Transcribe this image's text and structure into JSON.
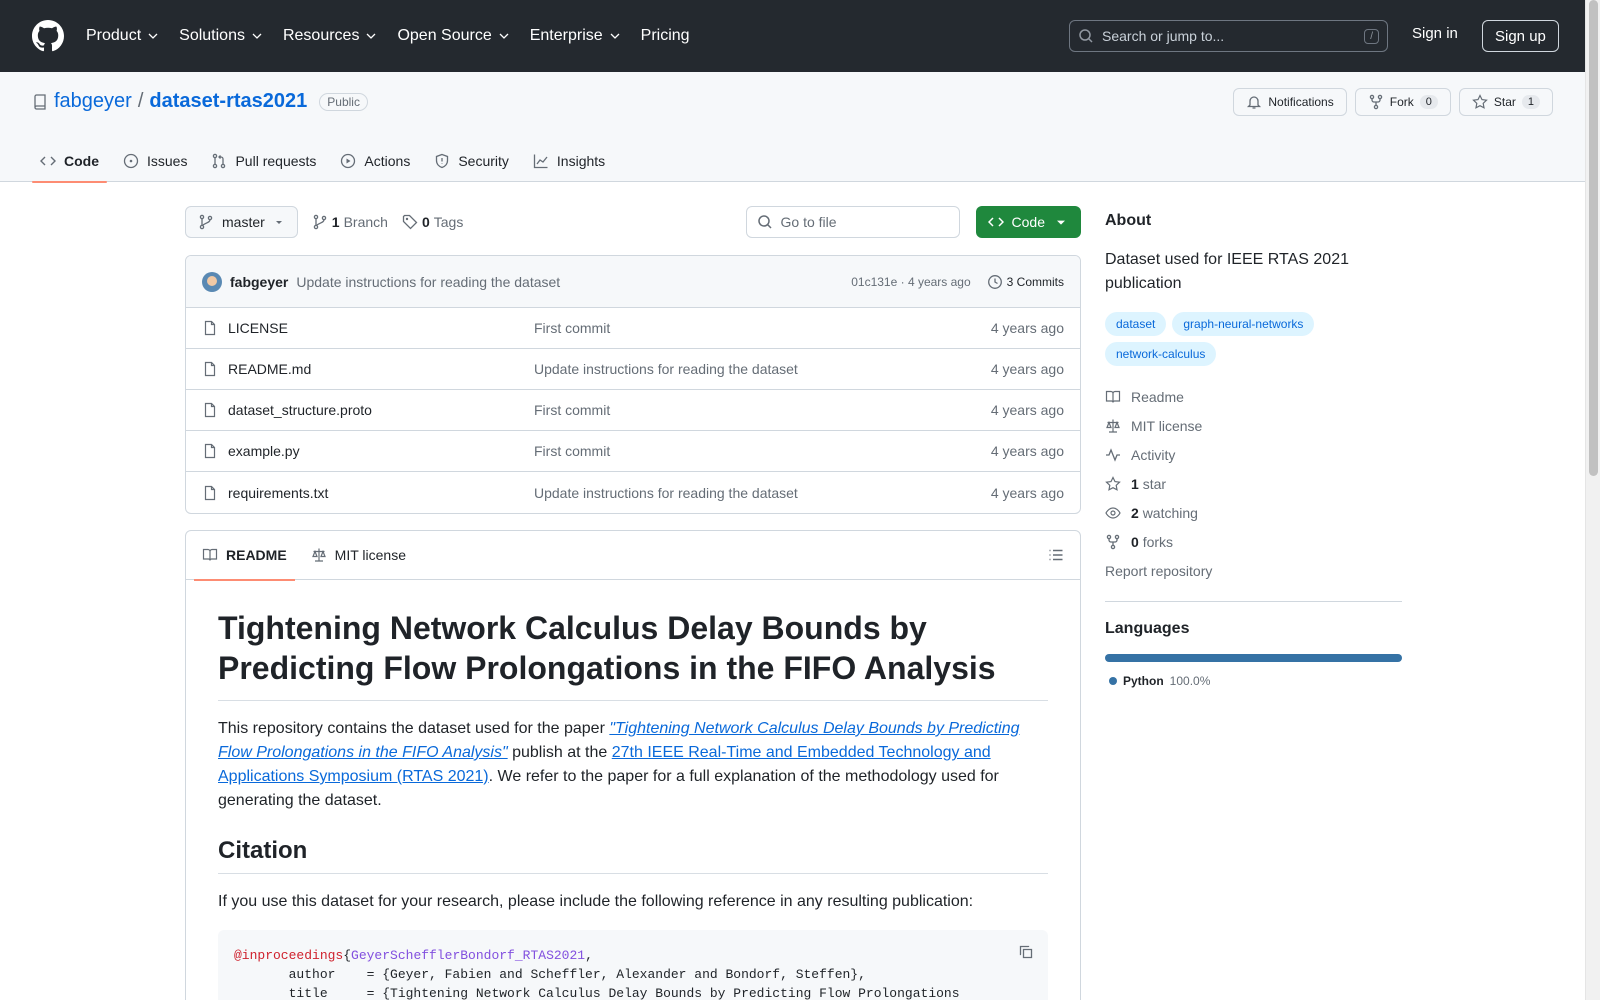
{
  "header": {
    "nav": [
      "Product",
      "Solutions",
      "Resources",
      "Open Source",
      "Enterprise",
      "Pricing"
    ],
    "search_placeholder": "Search or jump to...",
    "search_shortcut": "/",
    "sign_in": "Sign in",
    "sign_up": "Sign up"
  },
  "repo": {
    "owner": "fabgeyer",
    "separator": "/",
    "name": "dataset-rtas2021",
    "visibility": "Public",
    "notifications_label": "Notifications",
    "fork_label": "Fork",
    "fork_count": "0",
    "star_label": "Star",
    "star_count": "1",
    "tabs": [
      "Code",
      "Issues",
      "Pull requests",
      "Actions",
      "Security",
      "Insights"
    ]
  },
  "toolbar": {
    "branch": "master",
    "branch_count": "1",
    "branch_label": "Branch",
    "tag_count": "0",
    "tag_label": "Tags",
    "goto_placeholder": "Go to file",
    "code_button": "Code"
  },
  "commit": {
    "author": "fabgeyer",
    "message": "Update instructions for reading the dataset",
    "meta": "01c131e · 4 years ago",
    "commits_label": "3 Commits"
  },
  "files": [
    {
      "name": "LICENSE",
      "message": "First commit",
      "date": "4 years ago"
    },
    {
      "name": "README.md",
      "message": "Update instructions for reading the dataset",
      "date": "4 years ago"
    },
    {
      "name": "dataset_structure.proto",
      "message": "First commit",
      "date": "4 years ago"
    },
    {
      "name": "example.py",
      "message": "First commit",
      "date": "4 years ago"
    },
    {
      "name": "requirements.txt",
      "message": "Update instructions for reading the dataset",
      "date": "4 years ago"
    }
  ],
  "readme": {
    "tab_readme": "README",
    "tab_license": "MIT license",
    "title": "Tightening Network Calculus Delay Bounds by Predicting Flow Prolongations in the FIFO Analysis",
    "intro_pre": "This repository contains the dataset used for the paper ",
    "intro_link1": "\"Tightening Network Calculus Delay Bounds by Predicting Flow Prolongations in the FIFO Analysis\"",
    "intro_mid": " publish at the ",
    "intro_link2": "27th IEEE Real-Time and Embedded Technology and Applications Symposium (RTAS 2021)",
    "intro_post": ". We refer to the paper for a full explanation of the methodology used for generating the dataset.",
    "citation_heading": "Citation",
    "citation_text": "If you use this dataset for your research, please include the following reference in any resulting publication:",
    "code_kw": "@inproceedings",
    "code_brace": "{",
    "code_key": "GeyerSchefflerBondorf_RTAS2021",
    "code_line1_end": ",",
    "code_line2": "       author    = {Geyer, Fabien and Scheffler, Alexander and Bondorf, Steffen},",
    "code_line3": "       title     = {Tightening Network Calculus Delay Bounds by Predicting Flow Prolongations"
  },
  "sidebar": {
    "about": "About",
    "description": "Dataset used for IEEE RTAS 2021 publication",
    "topics": [
      "dataset",
      "graph-neural-networks",
      "network-calculus"
    ],
    "readme": "Readme",
    "license": "MIT license",
    "activity": "Activity",
    "stars_count": "1",
    "stars_label": "star",
    "watching_count": "2",
    "watching_label": "watching",
    "forks_count": "0",
    "forks_label": "forks",
    "report": "Report repository",
    "languages_heading": "Languages",
    "language_name": "Python",
    "language_pct": "100.0%"
  },
  "colors": {
    "header_bg": "#24292f",
    "accent": "#0969da",
    "primary_button": "#1f883d",
    "python": "#3572a5",
    "tab_underline": "#fd8c73"
  }
}
